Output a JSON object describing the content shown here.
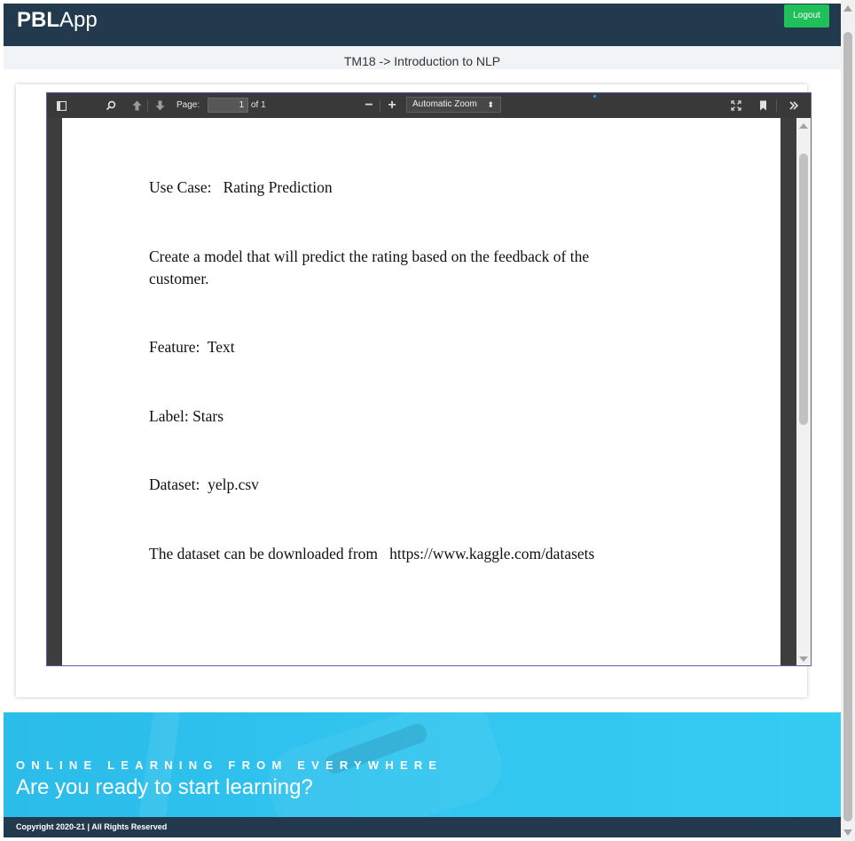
{
  "navbar": {
    "brand_bold": "PBL",
    "brand_rest": "App",
    "logout_label": "Logout"
  },
  "breadcrumb": {
    "text": "TM18 -> Introduction to NLP"
  },
  "pdf_viewer": {
    "toolbar": {
      "page_label": "Page:",
      "page_value": "1",
      "page_total": "of 1",
      "zoom_minus": "−",
      "zoom_plus": "+",
      "zoom_value": "Automatic Zoom",
      "icons": [
        "sidebar-toggle-icon",
        "search-icon",
        "previous-page-icon",
        "next-page-icon",
        "zoom-out-icon",
        "zoom-in-icon",
        "presentation-mode-icon",
        "bookmark-icon",
        "tools-icon"
      ]
    },
    "document": {
      "lines": [
        "Use Case:   Rating Prediction",
        "Create a model that will predict the rating based on the feedback of the",
        "customer.",
        "Feature:  Text",
        "Label: Stars",
        "Dataset:  yelp.csv",
        "The dataset can be downloaded from   https://www.kaggle.com/datasets"
      ]
    }
  },
  "banner": {
    "tagline": "ONLINE LEARNING FROM EVERYWHERE",
    "headline": "Are you ready to start learning?"
  },
  "footer": {
    "copyright": "Copyright 2020-21 | All Rights Reserved"
  },
  "colors": {
    "navbar_bg": "#233a4e",
    "logout_bg": "#1fbf5a",
    "banner_bg": "#32c6f0",
    "viewer_border": "#5b5fa8"
  }
}
